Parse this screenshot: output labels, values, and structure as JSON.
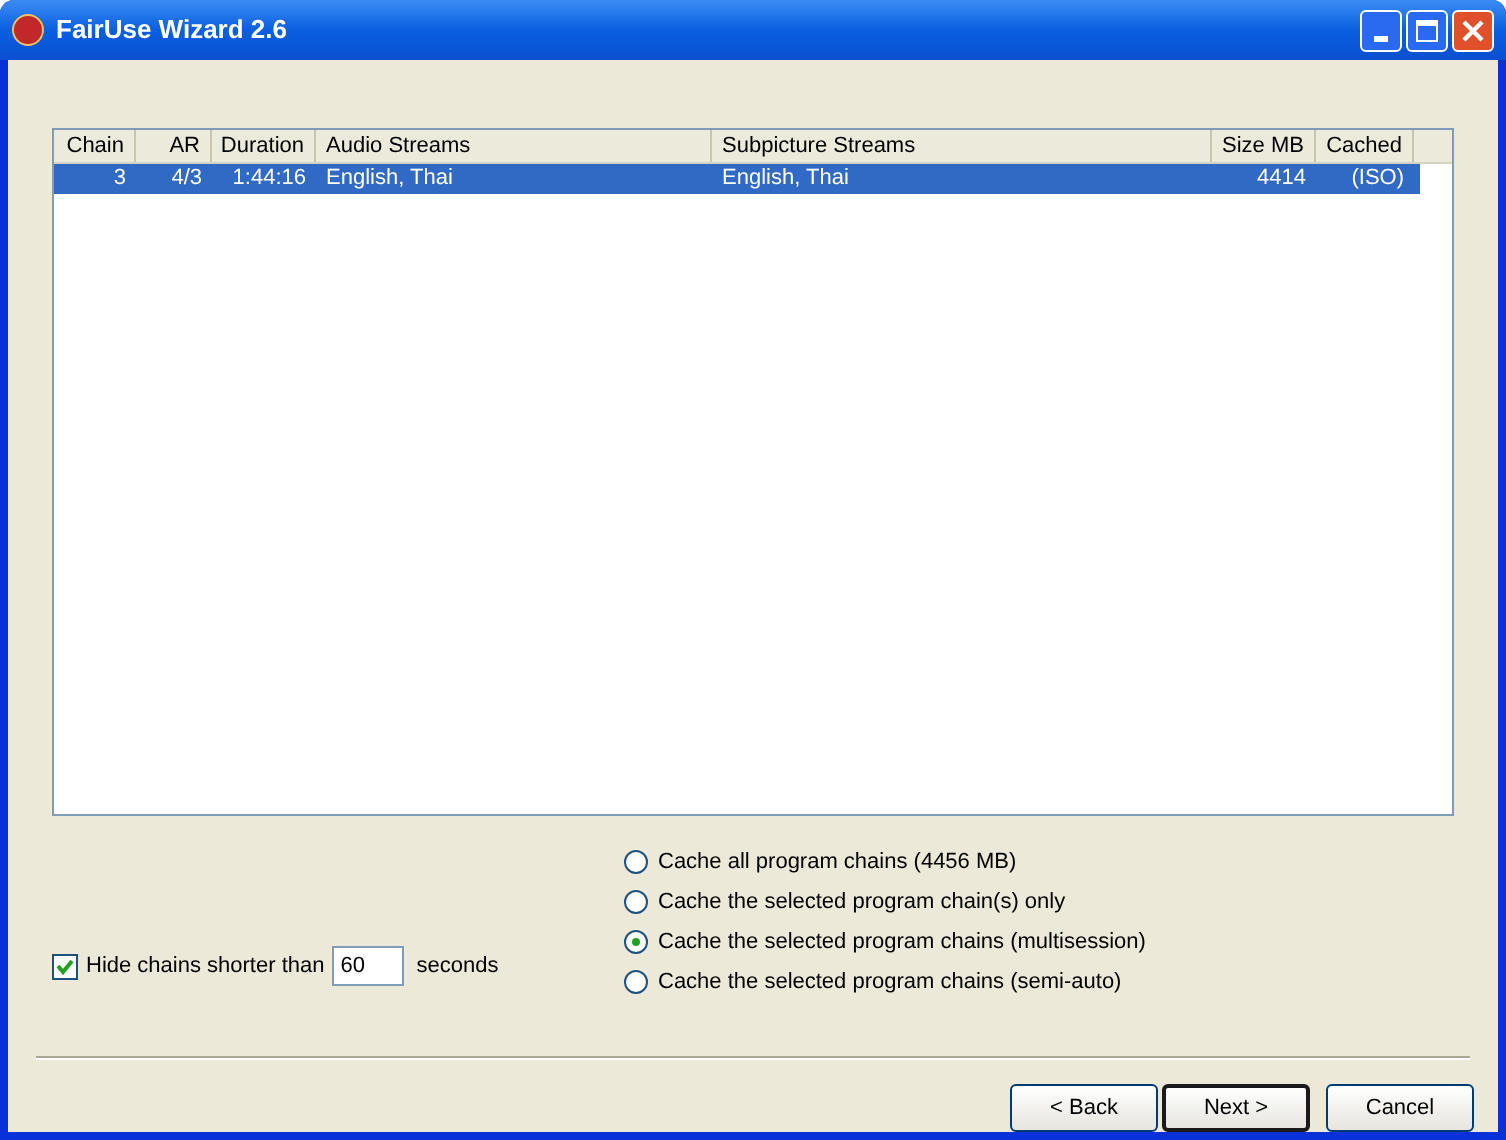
{
  "window": {
    "title": "FairUse Wizard 2.6"
  },
  "table": {
    "columns": [
      "Chain",
      "AR",
      "Duration",
      "Audio Streams",
      "Subpicture Streams",
      "Size MB",
      "Cached"
    ],
    "rows": [
      {
        "selected": true,
        "cells": [
          "3",
          "4/3",
          "1:44:16",
          "English, Thai",
          "English, Thai",
          "4414",
          "(ISO)"
        ]
      }
    ]
  },
  "hide_chains": {
    "checked": true,
    "label": "Hide chains shorter than",
    "value": "60",
    "unit": "seconds"
  },
  "cache_options": [
    {
      "label": "Cache all program chains (4456 MB)",
      "selected": false
    },
    {
      "label": "Cache the selected program chain(s) only",
      "selected": false
    },
    {
      "label": "Cache the selected program chains (multisession)",
      "selected": true
    },
    {
      "label": "Cache the selected program chains (semi-auto)",
      "selected": false
    }
  ],
  "buttons": [
    {
      "label": "< Back",
      "default": false
    },
    {
      "label": "Next >",
      "default": true
    },
    {
      "label": "Cancel",
      "default": false
    }
  ]
}
